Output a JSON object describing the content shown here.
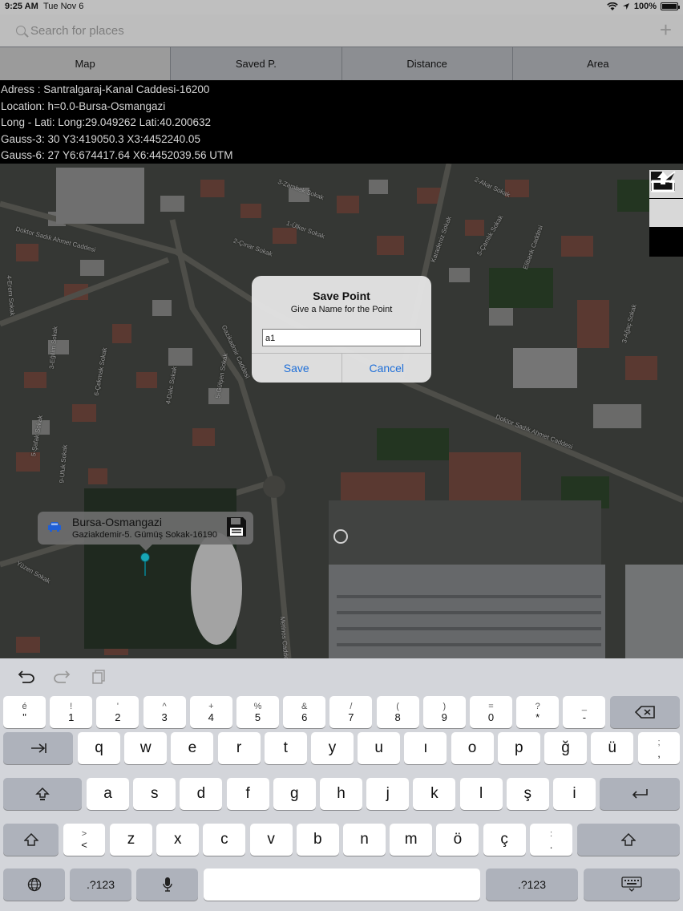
{
  "status": {
    "time": "9:25 AM",
    "date": "Tue Nov 6",
    "battery": "100%"
  },
  "search": {
    "placeholder": "Search for places",
    "add_icon": "plus-icon"
  },
  "tabs": [
    {
      "label": "Map"
    },
    {
      "label": "Saved P."
    },
    {
      "label": "Distance"
    },
    {
      "label": "Area"
    }
  ],
  "info": {
    "lines": [
      "Adress   : Santralgaraj-Kanal Caddesi-16200",
      "Location: h=0.0-Bursa-Osmangazi",
      "Long - Lati: Long:29.049262 Lati:40.200632",
      "Gauss-3: 30 Y3:419050.3 X3:4452240.05",
      "Gauss-6: 27 Y6:674417.64 X6:4452039.56 UTM"
    ]
  },
  "map": {
    "streets": [
      "3-Zambak Sokak",
      "Doktor Sadık Ahmet Caddesi",
      "1-Ülker Sokak",
      "2-Çınar Sokak",
      "Karadeniz Sokak",
      "2-Akar Sokak",
      "5-Çamlık Sokak",
      "Elibank Caddesi",
      "Gazikadmir Caddesi",
      "5-Gülşen Sokak",
      "4-Dalc Sokak",
      "6-Çekmak Sokak",
      "3-Eğilim Sokak",
      "4-Erem Sokak",
      "5-Şafak Sokak",
      "9-Ufuk Sokak",
      "Doktor Sadık Ahmet Caddesi",
      "Yüzen Sokak",
      "Metinos Caddesi",
      "3-Ağaç Sokak"
    ],
    "callout": {
      "title": "Bursa-Osmangazi",
      "subtitle": "Gaziakdemir-5. Gümüş Sokak-16190"
    }
  },
  "alert": {
    "title": "Save Point",
    "message": "Give a Name for the Point",
    "field_value": "a1",
    "save_label": "Save",
    "cancel_label": "Cancel"
  },
  "keyboard": {
    "row1": [
      [
        "é",
        "\""
      ],
      [
        "!",
        "1"
      ],
      [
        "'",
        "2"
      ],
      [
        "^",
        "3"
      ],
      [
        "+",
        "4"
      ],
      [
        "%",
        "5"
      ],
      [
        "&",
        "6"
      ],
      [
        "/",
        "7"
      ],
      [
        "(",
        "8"
      ],
      [
        ")",
        "9"
      ],
      [
        "=",
        "0"
      ],
      [
        "?",
        "*"
      ],
      [
        "_",
        "-"
      ]
    ],
    "row2": [
      "q",
      "w",
      "e",
      "r",
      "t",
      "y",
      "u",
      "ı",
      "o",
      "p",
      "ğ",
      "ü"
    ],
    "row2_last": [
      ";",
      ","
    ],
    "row3": [
      "a",
      "s",
      "d",
      "f",
      "g",
      "h",
      "j",
      "k",
      "l",
      "ş",
      "i"
    ],
    "row4_first": [
      ">",
      "<"
    ],
    "row4": [
      "z",
      "x",
      "c",
      "v",
      "b",
      "n",
      "m",
      "ö",
      "ç"
    ],
    "row4_last": [
      ":",
      "."
    ],
    "numbers_label": ".?123"
  }
}
